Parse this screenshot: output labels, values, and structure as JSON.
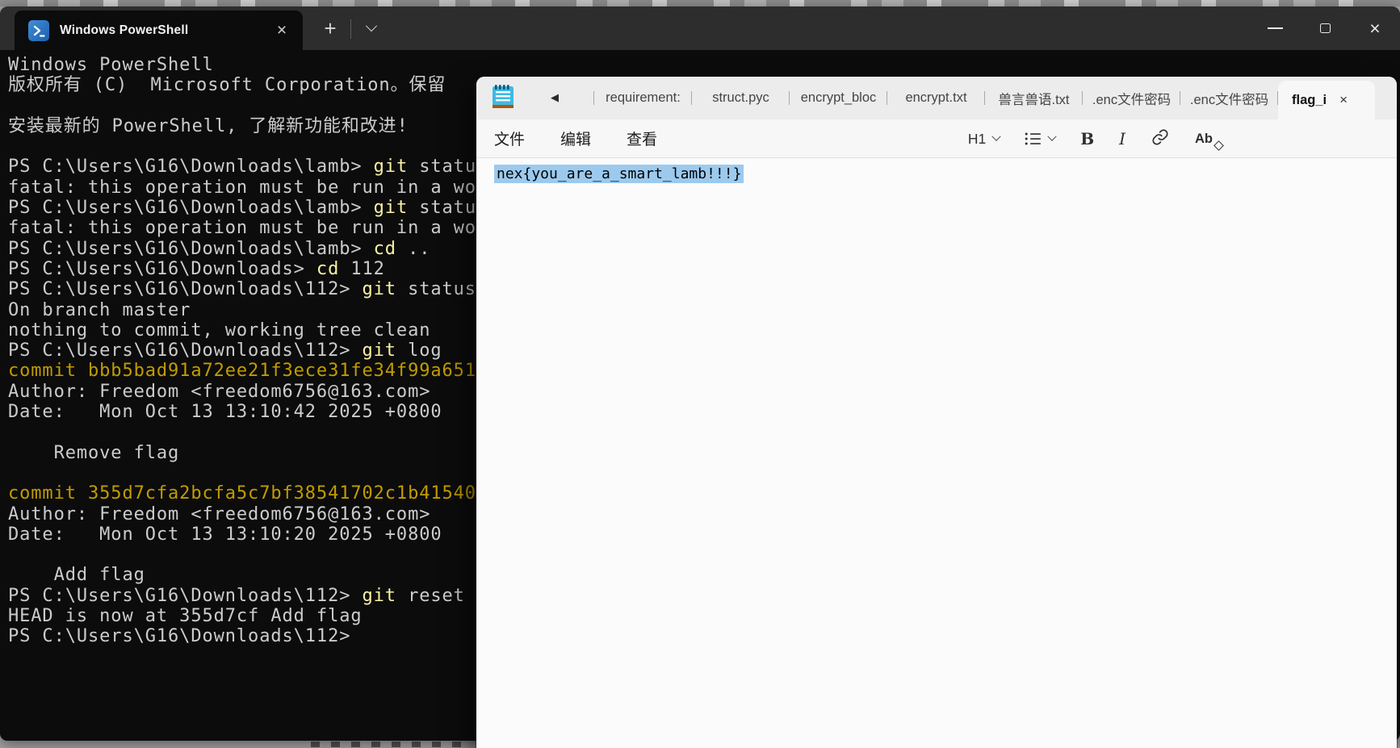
{
  "colors": {
    "terminal_background": "#0C0C0C",
    "terminal_titlebar": "#2D2D2D",
    "terminal_foreground": "#CCCCCC",
    "command_yellow": "#F9F1A5",
    "commit_hash_yellow": "#C19C00",
    "powershell_icon_blue": "#2B7CD3",
    "notepad_tabbar": "#ECECEC",
    "notepad_surface": "#F7F7F7",
    "selection_blue": "#9CCAEE",
    "notepad_icon_blue": "#3FB9E4",
    "notepad_icon_orange": "#B35309"
  },
  "terminal": {
    "tab_title": "Windows PowerShell",
    "tab_close_icon": "×",
    "new_tab_icon": "+",
    "window_close_icon": "×",
    "lines": [
      {
        "segs": [
          [
            "fg",
            "Windows PowerShell"
          ]
        ]
      },
      {
        "segs": [
          [
            "fg",
            "版权所有 (C)  Microsoft Corporation。保留"
          ]
        ]
      },
      {
        "segs": []
      },
      {
        "segs": [
          [
            "fg",
            "安装最新的 PowerShell, 了解新功能和改进!"
          ]
        ]
      },
      {
        "segs": []
      },
      {
        "segs": [
          [
            "fg",
            "PS C:\\Users\\G16\\Downloads\\lamb> "
          ],
          [
            "cmd",
            "git"
          ],
          [
            "fg",
            " statu"
          ]
        ]
      },
      {
        "segs": [
          [
            "fg",
            "fatal: this operation must be run in a wo"
          ]
        ]
      },
      {
        "segs": [
          [
            "fg",
            "PS C:\\Users\\G16\\Downloads\\lamb> "
          ],
          [
            "cmd",
            "git"
          ],
          [
            "fg",
            " statu"
          ]
        ]
      },
      {
        "segs": [
          [
            "fg",
            "fatal: this operation must be run in a wo"
          ]
        ]
      },
      {
        "segs": [
          [
            "fg",
            "PS C:\\Users\\G16\\Downloads\\lamb> "
          ],
          [
            "cmd",
            "cd"
          ],
          [
            "fg",
            " .."
          ]
        ]
      },
      {
        "segs": [
          [
            "fg",
            "PS C:\\Users\\G16\\Downloads> "
          ],
          [
            "cmd",
            "cd"
          ],
          [
            "fg",
            " 112"
          ]
        ]
      },
      {
        "segs": [
          [
            "fg",
            "PS C:\\Users\\G16\\Downloads\\112> "
          ],
          [
            "cmd",
            "git"
          ],
          [
            "fg",
            " status"
          ]
        ]
      },
      {
        "segs": [
          [
            "fg",
            "On branch master"
          ]
        ]
      },
      {
        "segs": [
          [
            "fg",
            "nothing to commit, working tree clean"
          ]
        ]
      },
      {
        "segs": [
          [
            "fg",
            "PS C:\\Users\\G16\\Downloads\\112> "
          ],
          [
            "cmd",
            "git"
          ],
          [
            "fg",
            " log"
          ]
        ]
      },
      {
        "segs": [
          [
            "hash",
            "commit bbb5bad91a72ee21f3ece31fe34f99a651"
          ]
        ]
      },
      {
        "segs": [
          [
            "fg",
            "Author: Freedom <freedom6756@163.com>"
          ]
        ]
      },
      {
        "segs": [
          [
            "fg",
            "Date:   Mon Oct 13 13:10:42 2025 +0800"
          ]
        ]
      },
      {
        "segs": []
      },
      {
        "segs": [
          [
            "fg",
            "    Remove flag"
          ]
        ]
      },
      {
        "segs": []
      },
      {
        "segs": [
          [
            "hash",
            "commit 355d7cfa2bcfa5c7bf38541702c1b41540"
          ]
        ]
      },
      {
        "segs": [
          [
            "fg",
            "Author: Freedom <freedom6756@163.com>"
          ]
        ]
      },
      {
        "segs": [
          [
            "fg",
            "Date:   Mon Oct 13 13:10:20 2025 +0800"
          ]
        ]
      },
      {
        "segs": []
      },
      {
        "segs": [
          [
            "fg",
            "    Add flag"
          ]
        ]
      },
      {
        "segs": [
          [
            "fg",
            "PS C:\\Users\\G16\\Downloads\\112> "
          ],
          [
            "cmd",
            "git"
          ],
          [
            "fg",
            " reset"
          ]
        ]
      },
      {
        "segs": [
          [
            "fg",
            "HEAD is now at 355d7cf Add flag"
          ]
        ]
      },
      {
        "segs": [
          [
            "fg",
            "PS C:\\Users\\G16\\Downloads\\112>"
          ]
        ]
      }
    ]
  },
  "notepad": {
    "tab_scroll_left_icon": "◀",
    "tab_close_icon": "×",
    "tabs": [
      {
        "label": "requirement:",
        "active": false
      },
      {
        "label": "struct.pyc",
        "active": false
      },
      {
        "label": "encrypt_bloc",
        "active": false
      },
      {
        "label": "encrypt.txt",
        "active": false
      },
      {
        "label": "兽言兽语.txt",
        "active": false
      },
      {
        "label": ".enc文件密码",
        "active": false
      },
      {
        "label": ".enc文件密码",
        "active": false
      },
      {
        "label": "flag_i",
        "active": true
      }
    ],
    "menu": [
      "文件",
      "编辑",
      "查看"
    ],
    "toolbar": {
      "heading_label": "H1",
      "bold_label": "B",
      "italic_label": "I",
      "clear_format_label": "Ab"
    },
    "editor": {
      "selected_text": "nex{you_are_a_smart_lamb!!!}"
    }
  }
}
